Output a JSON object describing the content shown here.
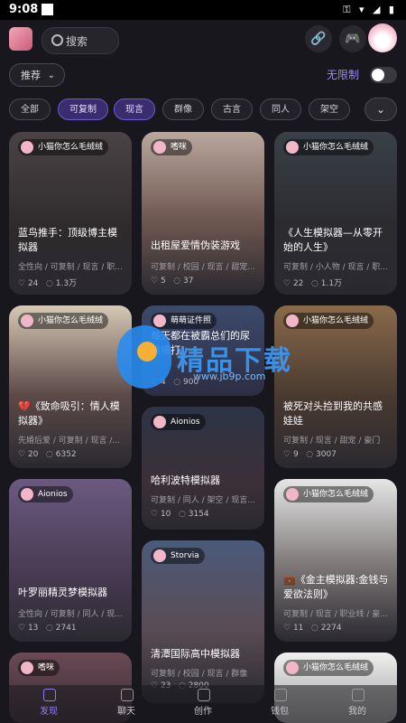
{
  "status_bar": {
    "time": "9:08",
    "icons": "⚿ ▾ ◢ ▮"
  },
  "header": {
    "search_placeholder": "搜索",
    "link_icon": "link-icon",
    "avatar_icon": "mascot-avatar"
  },
  "filters": {
    "sort_label": "推荐",
    "unlimited_label": "无限制",
    "toggle_on": false
  },
  "tags": [
    {
      "label": "全部",
      "active": false
    },
    {
      "label": "可复制",
      "active": true
    },
    {
      "label": "现言",
      "active": true
    },
    {
      "label": "群像",
      "active": false
    },
    {
      "label": "古言",
      "active": false
    },
    {
      "label": "同人",
      "active": false
    },
    {
      "label": "架空",
      "active": false
    }
  ],
  "cards": [
    {
      "author": "小猫你怎么毛绒绒",
      "title": "蓝鸟推手：顶级博主模拟器",
      "tags": "全性向 / 可复制 / 现言 / 职...",
      "likes": "24",
      "comments": "1.3万"
    },
    {
      "author": "嗜咪",
      "title": "出租屋爱情伪装游戏",
      "tags": "可复制 / 校园 / 现言 / 甜宠...",
      "likes": "5",
      "comments": "37"
    },
    {
      "author": "小猫你怎么毛绒绒",
      "title": "《人生模拟器—从零开始的人生》",
      "tags": "可复制 / 小人物 / 现言 / 职...",
      "likes": "22",
      "comments": "1.1万"
    },
    {
      "author": "小猫你怎么毛绒绒",
      "title": "💔《致命吸引：情人模拟器》",
      "tags": "先婚后爱 / 可复制 / 现言 /...",
      "likes": "20",
      "comments": "6352"
    },
    {
      "author": "萌萌证件照",
      "title": "每天都在被霸总们的尿情接打",
      "tags": "",
      "likes": "4",
      "comments": "900"
    },
    {
      "author": "小猫你怎么毛绒绒",
      "title": "被死对头捡到我的共感娃娃",
      "tags": "可复制 / 现言 / 甜宠 / 豪门",
      "likes": "9",
      "comments": "3007"
    },
    {
      "author": "Aionios",
      "title": "哈利波特模拟器",
      "tags": "可复制 / 同人 / 架空 / 现言...",
      "likes": "10",
      "comments": "3154"
    },
    {
      "author": "Aionios",
      "title": "叶罗丽精灵梦模拟器",
      "tags": "全性向 / 可复制 / 同人 / 现...",
      "likes": "13",
      "comments": "2741"
    },
    {
      "author": "小猫你怎么毛绒绒",
      "title": "💼《金主模拟器:金钱与爱欲法则》",
      "tags": "可复制 / 现言 / 职业线 / 豪...",
      "likes": "11",
      "comments": "2274"
    },
    {
      "author": "Storvia",
      "title": "清潭国际高中模拟器",
      "tags": "可复制 / 校园 / 现言 / 群像",
      "likes": "23",
      "comments": "2800"
    },
    {
      "author": "嗜咪",
      "title": "",
      "tags": "",
      "likes": "",
      "comments": ""
    },
    {
      "author": "小猫你怎么毛绒绒",
      "title": "",
      "tags": "",
      "likes": "",
      "comments": ""
    }
  ],
  "watermark": {
    "text": "精品下载",
    "url": "www.jb9p.com"
  },
  "bottom_nav": [
    {
      "label": "发现",
      "active": true
    },
    {
      "label": "聊天",
      "active": false
    },
    {
      "label": "创作",
      "active": false
    },
    {
      "label": "钱包",
      "active": false
    },
    {
      "label": "我的",
      "active": false
    }
  ],
  "colors": {
    "background": "#18171d",
    "accent": "#8e7ef0",
    "tag_active": "#3a2c6e"
  }
}
